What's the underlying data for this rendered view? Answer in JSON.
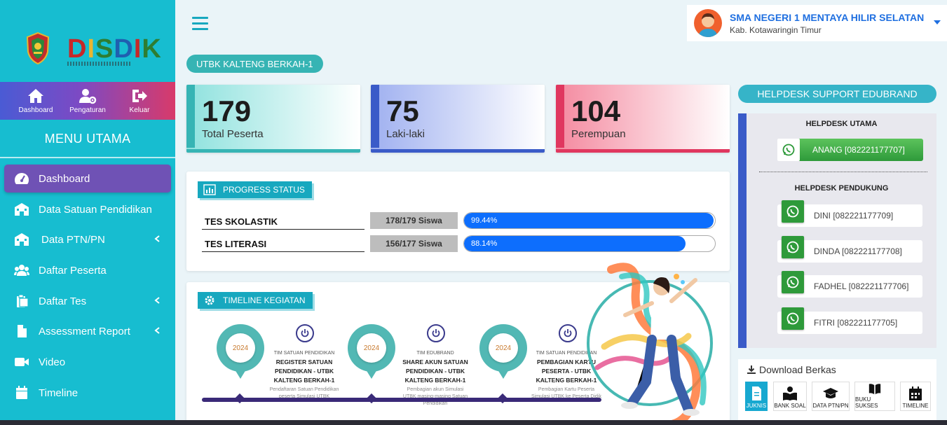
{
  "brand": {
    "logo_text": "DISDIK",
    "colors": {
      "sidebar": "#17bdd0",
      "active": "#6f52b5",
      "accent": "#17a8bf"
    }
  },
  "quickbar": [
    {
      "label": "Dashboard",
      "icon": "home-icon"
    },
    {
      "label": "Pengaturan",
      "icon": "user-gear-icon"
    },
    {
      "label": "Keluar",
      "icon": "logout-icon"
    }
  ],
  "menu": {
    "title": "MENU UTAMA",
    "items": [
      {
        "label": "Dashboard",
        "icon": "dashboard-gauge-icon",
        "active": true
      },
      {
        "label": "Data Satuan Pendidikan",
        "icon": "school-icon"
      },
      {
        "label": "Data PTN/PN",
        "icon": "university-icon",
        "submenu": true
      },
      {
        "label": "Daftar Peserta",
        "icon": "users-icon"
      },
      {
        "label": "Daftar Tes",
        "icon": "clipboard-icon",
        "submenu": true
      },
      {
        "label": "Assessment Report",
        "icon": "file-icon",
        "submenu": true
      },
      {
        "label": "Video",
        "icon": "video-icon"
      },
      {
        "label": "Timeline",
        "icon": "calendar-icon"
      }
    ]
  },
  "header": {
    "school_name": "SMA NEGERI 1 MENTAYA HILIR SELATAN",
    "school_region": "Kab. Kotawaringin Timur"
  },
  "event": {
    "label": "UTBK KALTENG BERKAH-1"
  },
  "stats": [
    {
      "value": "179",
      "label": "Total Peserta",
      "color": "#36b4b4"
    },
    {
      "value": "75",
      "label": "Laki-laki",
      "color": "#3a5bc8"
    },
    {
      "value": "104",
      "label": "Perempuan",
      "color": "#e0375f"
    }
  ],
  "progress": {
    "title": "PROGRESS STATUS",
    "rows": [
      {
        "label": "TES SKOLASTIK",
        "count": "178/179 Siswa",
        "percent_text": "99.44%",
        "percent": 99.44
      },
      {
        "label": "TES LITERASI",
        "count": "156/177 Siswa",
        "percent_text": "88.14%",
        "percent": 88.14
      }
    ]
  },
  "timeline": {
    "title": "TIMELINE KEGIATAN",
    "events": [
      {
        "year": "2024",
        "team": "TIM SATUAN PENDIDIKAN",
        "title": "REGISTER SATUAN PENDIDIKAN - UTBK KALTENG BERKAH-1",
        "desc": "Pendaftaran Satuan Pendidikan peserta Simulasi UTBK"
      },
      {
        "year": "2024",
        "team": "TIM EDUBRAND",
        "title": "SHARE AKUN SATUAN PENDIDIKAN - UTBK KALTENG BERKAH-1",
        "desc": "Pembagian akun Simulasi UTBK masing-masing Satuan Pendidikan"
      },
      {
        "year": "2024",
        "team": "TIM SATUAN PENDIDIKAN",
        "title": "PEMBAGIAN KARTU PESERTA - UTBK KALTENG BERKAH-1",
        "desc": "Pembagian Kartu Peserta Simulasi UTBK ke Peserta Didik"
      }
    ]
  },
  "helpdesk": {
    "title": "HELPDESK SUPPORT EDUBRAND",
    "main_heading": "HELPDESK UTAMA",
    "main_contact": "ANANG [082221177707]",
    "support_heading": "HELPDESK PENDUKUNG",
    "support_contacts": [
      "DINI [082221177709]",
      "DINDA [082221177708]",
      "FADHEL [082221177706]",
      "FITRI [082221177705]"
    ]
  },
  "downloads": {
    "title": "Download Berkas",
    "items": [
      {
        "label": "JUKNIS",
        "icon": "document-icon",
        "active": true
      },
      {
        "label": "BANK SOAL",
        "icon": "reader-icon"
      },
      {
        "label": "DATA PTN/PN",
        "icon": "graduation-cap-icon"
      },
      {
        "label": "BUKU SUKSES",
        "icon": "book-icon"
      },
      {
        "label": "TIMELINE",
        "icon": "calendar-icon"
      }
    ]
  }
}
